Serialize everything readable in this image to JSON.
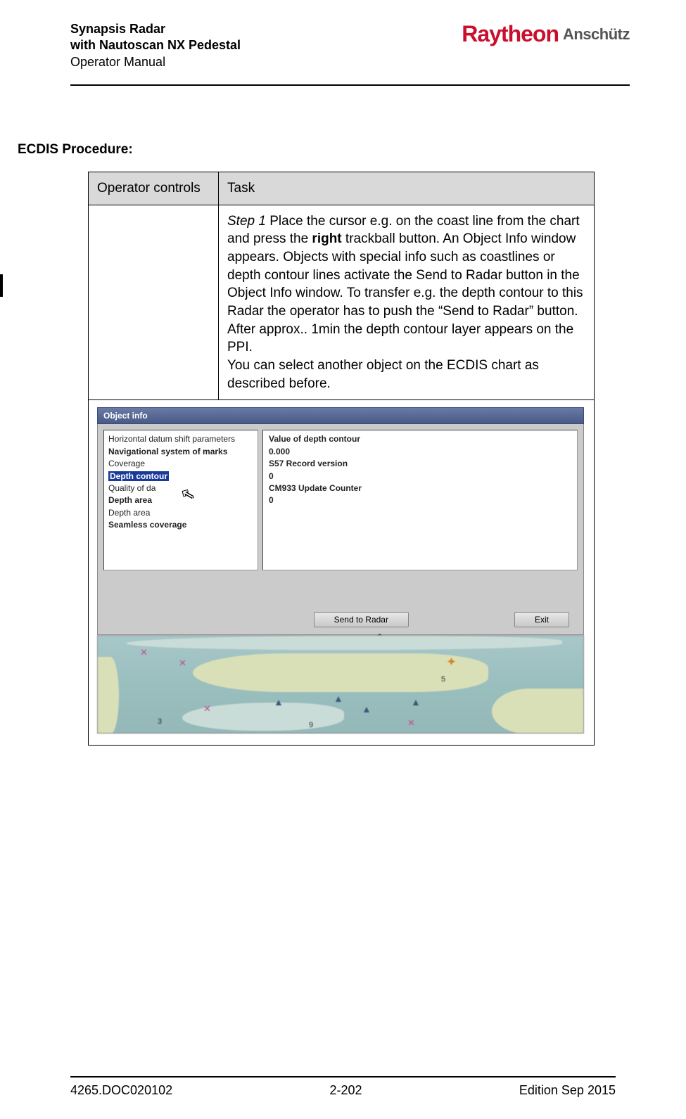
{
  "header": {
    "line1": "Synapsis Radar",
    "line2": "with Nautoscan NX Pedestal",
    "line3": "Operator Manual",
    "logo_left": "Raytheon",
    "logo_right": "Anschütz"
  },
  "section_title": "ECDIS Procedure:",
  "table": {
    "head_op": "Operator controls",
    "head_task": "Task",
    "step1_label": "Step 1",
    "step1_text_a": " Place the cursor e.g. on the coast line from the chart and press the ",
    "step1_bold": "right",
    "step1_text_b": " trackball button. An Object Info window appears. Objects with special info such as coastlines or depth contour lines activate the Send to Radar button in the Object Info window. To transfer e.g. the depth contour to this Radar the operator has to push the “Send to Radar” button. After approx.. 1min the depth contour layer appears on the PPI.",
    "step1_text_c": "You can select another object on the ECDIS chart as described before."
  },
  "object_info": {
    "title": "Object info",
    "list": [
      {
        "text": "Horizontal datum shift parameters",
        "bold": false
      },
      {
        "text": "Navigational system of marks",
        "bold": true
      },
      {
        "text": "Coverage",
        "bold": false
      },
      {
        "text": "Depth contour",
        "bold": true,
        "selected": true
      },
      {
        "text": "Quality of da",
        "bold": false
      },
      {
        "text": "Depth area",
        "bold": true
      },
      {
        "text": "Depth area",
        "bold": false
      },
      {
        "text": "Seamless coverage",
        "bold": true
      }
    ],
    "values": {
      "l1": "Value of depth contour",
      "l2": "  0.000",
      "l3": "S57 Record version",
      "l4": "  0",
      "l5": "CM933 Update Counter",
      "l6": "  0"
    },
    "btn_send": "Send to Radar",
    "btn_exit": "Exit"
  },
  "footer": {
    "left": "4265.DOC020102",
    "center": "2-202",
    "right": "Edition Sep 2015"
  }
}
